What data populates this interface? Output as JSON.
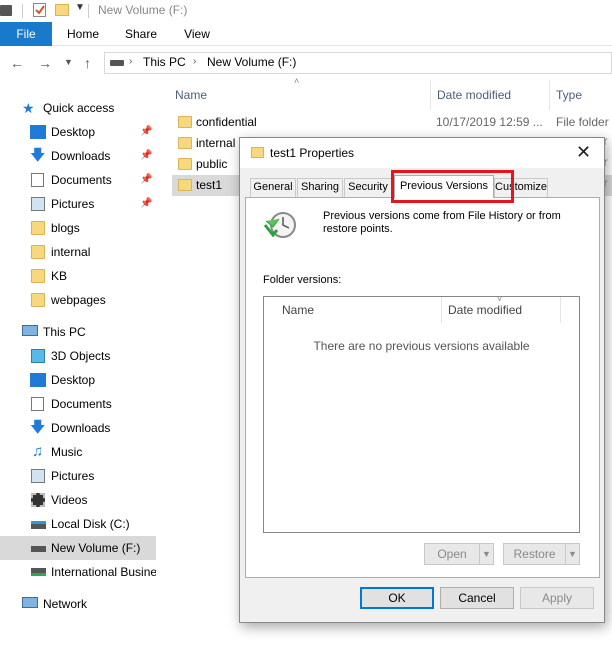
{
  "window": {
    "title": "New Volume (F:)"
  },
  "ribbon": {
    "tabs": [
      "File",
      "Home",
      "Share",
      "View"
    ]
  },
  "address": {
    "crumbs": [
      "This PC",
      "New Volume (F:)"
    ]
  },
  "nav": {
    "items": [
      {
        "label": "Quick access",
        "icon": "star-icon"
      },
      {
        "label": "Desktop",
        "icon": "desktop-icon"
      },
      {
        "label": "Downloads",
        "icon": "download-icon"
      },
      {
        "label": "Documents",
        "icon": "document-icon"
      },
      {
        "label": "Pictures",
        "icon": "picture-icon"
      },
      {
        "label": "blogs",
        "icon": "folder-icon"
      },
      {
        "label": "internal",
        "icon": "folder-icon"
      },
      {
        "label": "KB",
        "icon": "folder-icon"
      },
      {
        "label": "webpages",
        "icon": "folder-icon"
      },
      {
        "label": "This PC",
        "icon": "computer-icon"
      },
      {
        "label": "3D Objects",
        "icon": "cube-icon"
      },
      {
        "label": "Desktop",
        "icon": "desktop-icon"
      },
      {
        "label": "Documents",
        "icon": "document-icon"
      },
      {
        "label": "Downloads",
        "icon": "download-icon"
      },
      {
        "label": "Music",
        "icon": "music-icon"
      },
      {
        "label": "Pictures",
        "icon": "picture-icon"
      },
      {
        "label": "Videos",
        "icon": "video-icon"
      },
      {
        "label": "Local Disk (C:)",
        "icon": "drive-icon"
      },
      {
        "label": "New Volume (F:)",
        "icon": "drive-icon"
      },
      {
        "label": "International Busine",
        "icon": "network-drive-icon"
      },
      {
        "label": "Network",
        "icon": "network-icon"
      }
    ]
  },
  "filelist": {
    "columns": [
      "Name",
      "Date modified",
      "Type"
    ],
    "rows": [
      {
        "name": "confidential",
        "date": "10/17/2019 12:59 ...",
        "type": "File folder"
      },
      {
        "name": "internal",
        "date": "",
        "type": ""
      },
      {
        "name": "public",
        "date": "",
        "type": ""
      },
      {
        "name": "test1",
        "date": "",
        "type": ""
      }
    ]
  },
  "dialog": {
    "title": "test1 Properties",
    "tabs": [
      "General",
      "Sharing",
      "Security",
      "Previous Versions",
      "Customize"
    ],
    "active_tab": "Previous Versions",
    "description": "Previous versions come from File History or from restore points.",
    "folder_versions_label": "Folder versions:",
    "list_columns": [
      "Name",
      "Date modified"
    ],
    "empty_message": "There are no previous versions available",
    "buttons": {
      "open": "Open",
      "restore": "Restore",
      "ok": "OK",
      "cancel": "Cancel",
      "apply": "Apply"
    }
  },
  "colors": {
    "accent": "#1979ca",
    "highlight": "#e8141d"
  }
}
